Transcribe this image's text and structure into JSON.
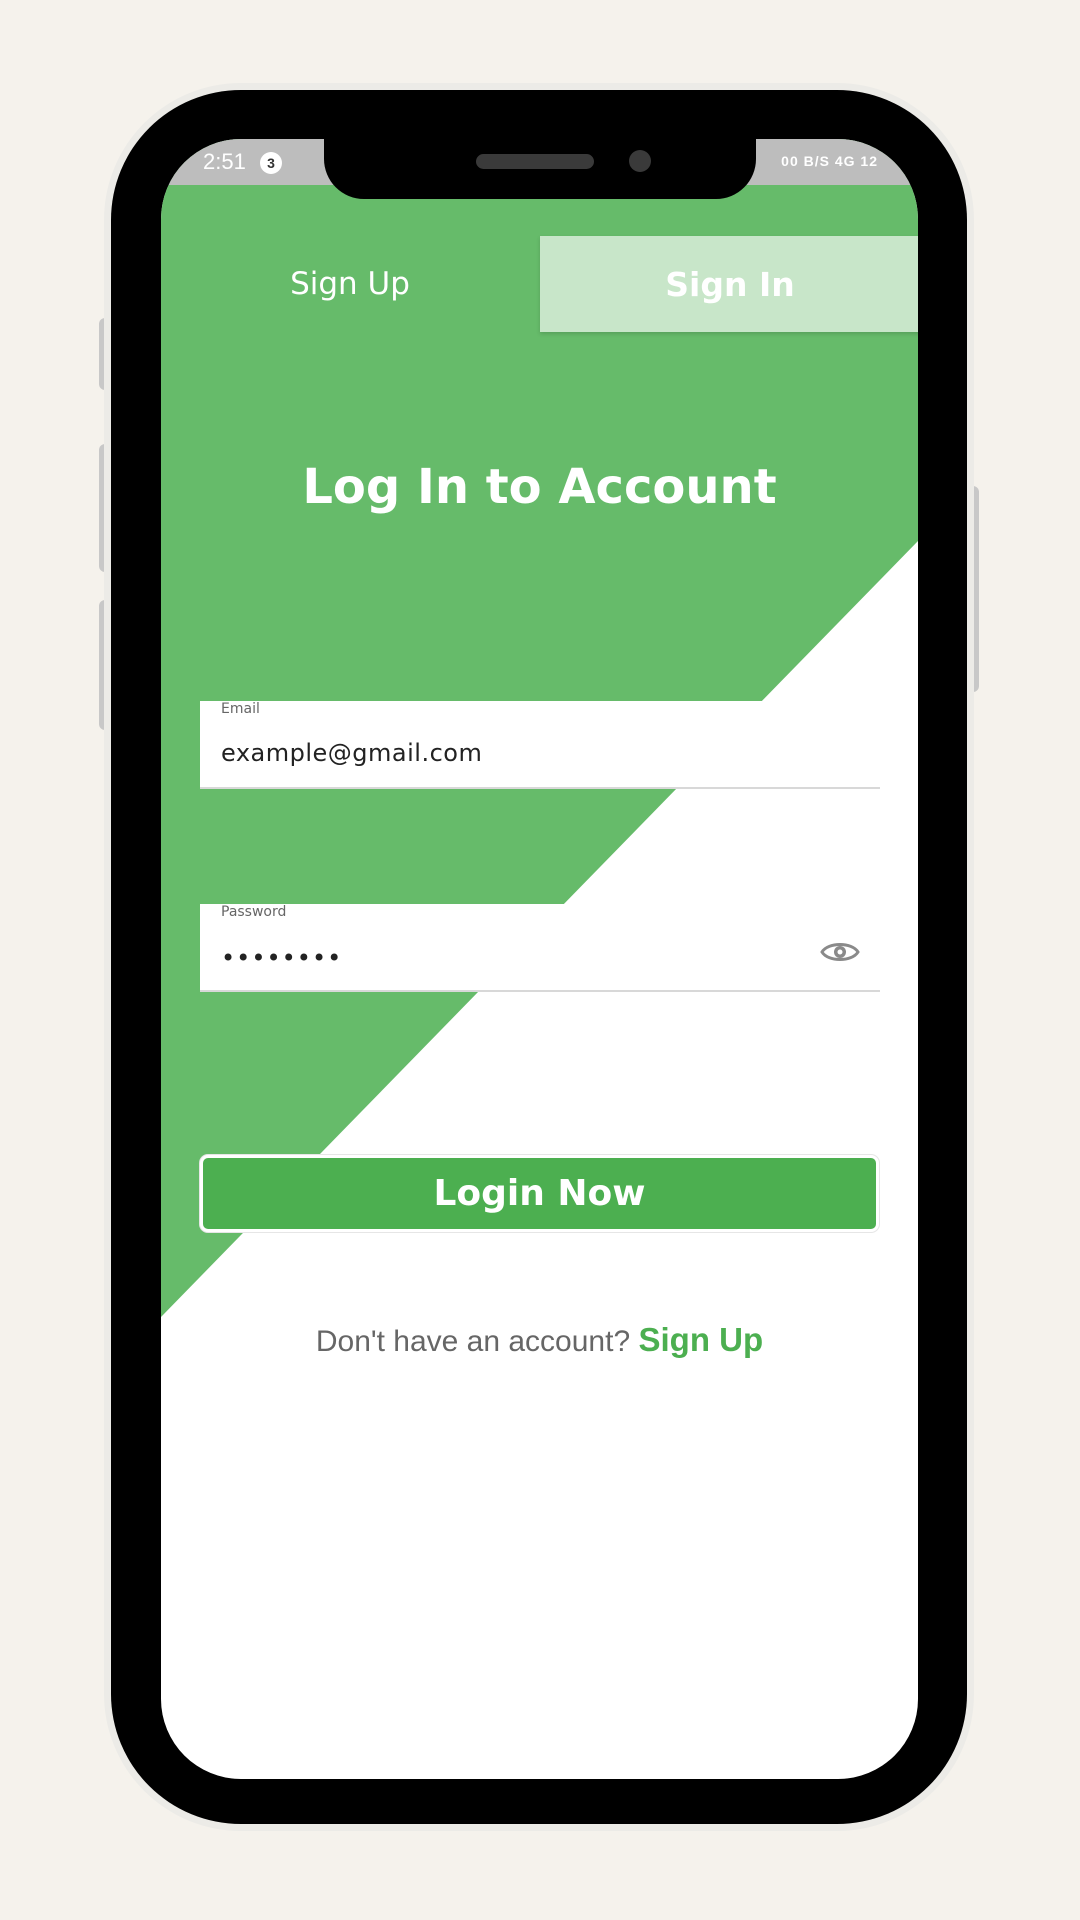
{
  "status_bar": {
    "time": "2:51",
    "notification_count": "3",
    "right_indicators": "00 B/S  4G  12"
  },
  "tabs": {
    "sign_up": "Sign Up",
    "sign_in": "Sign In",
    "active": "sign_in"
  },
  "page_title": "Log In to Account",
  "form": {
    "email": {
      "label": "Email",
      "value": "example@gmail.com"
    },
    "password": {
      "label": "Password",
      "value": "••••••••",
      "toggle_icon": "eye-icon"
    }
  },
  "login_button_label": "Login Now",
  "footer": {
    "prompt": "Don't have an account?",
    "link": "Sign Up"
  },
  "colors": {
    "primary_green": "#66bb6a",
    "button_green": "#4caf50",
    "active_tab_bg": "#c8e6c9",
    "page_bg": "#f5f2ec"
  }
}
